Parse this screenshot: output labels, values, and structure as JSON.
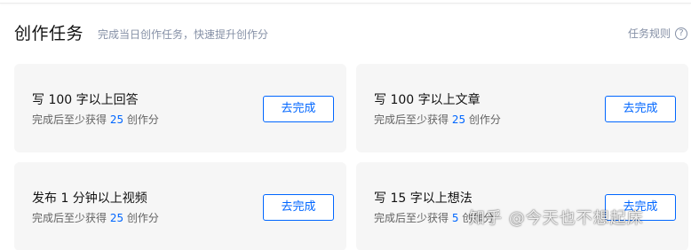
{
  "header": {
    "title": "创作任务",
    "subtitle": "完成当日创作任务，快速提升创作分",
    "rules_label": "任务规则",
    "help_glyph": "?"
  },
  "tasks": [
    {
      "title": "写 100 字以上回答",
      "sub_prefix": "完成后至少获得 ",
      "points": "25",
      "sub_suffix": " 创作分",
      "button": "去完成"
    },
    {
      "title": "写 100 字以上文章",
      "sub_prefix": "完成后至少获得 ",
      "points": "25",
      "sub_suffix": " 创作分",
      "button": "去完成"
    },
    {
      "title": "发布 1 分钟以上视频",
      "sub_prefix": "完成后至少获得 ",
      "points": "25",
      "sub_suffix": " 创作分",
      "button": "去完成"
    },
    {
      "title": "写 15 字以上想法",
      "sub_prefix": "完成后至少获得 ",
      "points": "5",
      "sub_suffix": " 创作分",
      "button": "去完成"
    }
  ],
  "watermark": "知乎 @今天也不想起床",
  "colors": {
    "accent": "#0066ff",
    "card_bg": "#f6f6f6",
    "muted": "#8590a6"
  }
}
